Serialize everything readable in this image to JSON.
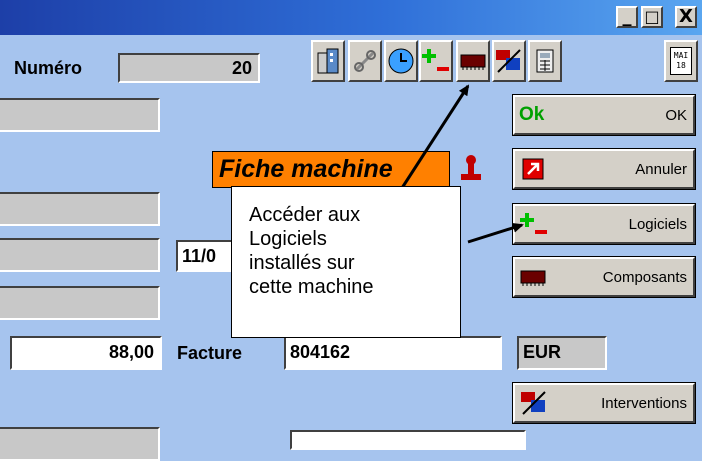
{
  "window": {
    "minimize_glyph": "_",
    "maximize_glyph": "□",
    "close_glyph": "X"
  },
  "numero": {
    "label": "Numéro",
    "value": "20"
  },
  "toolbar": {
    "icons": [
      "building-icon",
      "link-icon",
      "clock-icon",
      "plus-minus-icon",
      "memory-chip-icon",
      "intervention-icon",
      "calculator-icon",
      "calendar-icon"
    ],
    "calendar_text": "MAI 18"
  },
  "title": {
    "text": "Fiche machine"
  },
  "date_field": {
    "value": "11/0"
  },
  "amount": {
    "value": "88,00"
  },
  "facture": {
    "label": "Facture",
    "value": "804162"
  },
  "currency": {
    "value": "EUR"
  },
  "buttons": {
    "ok": {
      "icon_text": "Ok",
      "label": "OK"
    },
    "annuler": {
      "label": "Annuler"
    },
    "logiciels": {
      "label": "Logiciels"
    },
    "composants": {
      "label": "Composants"
    },
    "interventions": {
      "label": "Interventions"
    }
  },
  "callout": {
    "lines": [
      "Accéder aux",
      "Logiciels",
      "installés sur",
      "cette machine"
    ]
  },
  "colors": {
    "background": "#a6c4ee",
    "title_bg": "#ff8000",
    "ok_green": "#00a000",
    "plus_green": "#00c000",
    "minus_red": "#e00000"
  }
}
